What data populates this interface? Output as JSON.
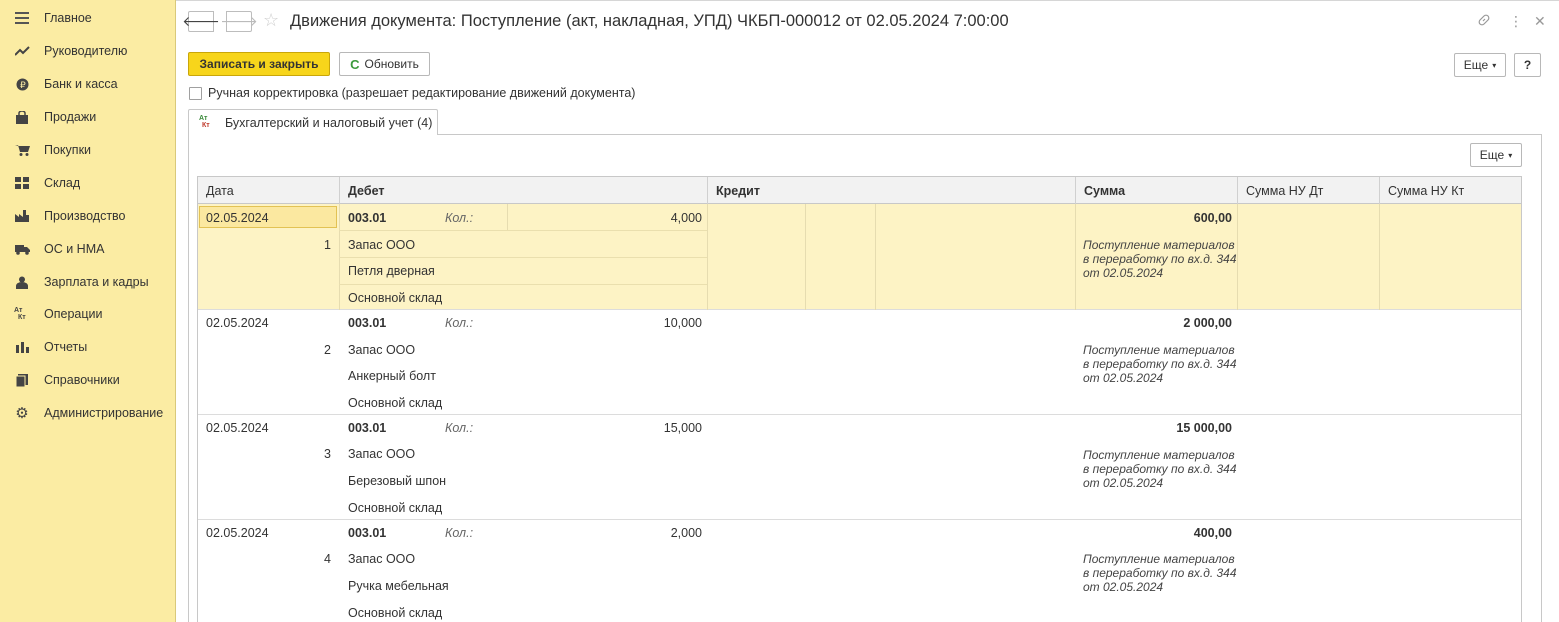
{
  "sidebar": {
    "items": [
      {
        "label": "Главное",
        "icon": "menu-icon"
      },
      {
        "label": "Руководителю",
        "icon": "trend-icon"
      },
      {
        "label": "Банк и касса",
        "icon": "coin-icon"
      },
      {
        "label": "Продажи",
        "icon": "bag-icon"
      },
      {
        "label": "Покупки",
        "icon": "cart-icon"
      },
      {
        "label": "Склад",
        "icon": "warehouse-icon"
      },
      {
        "label": "Производство",
        "icon": "factory-icon"
      },
      {
        "label": "ОС и НМА",
        "icon": "truck-icon"
      },
      {
        "label": "Зарплата и кадры",
        "icon": "person-icon"
      },
      {
        "label": "Операции",
        "icon": "dt-kt-icon"
      },
      {
        "label": "Отчеты",
        "icon": "bar-chart-icon"
      },
      {
        "label": "Справочники",
        "icon": "book-icon"
      },
      {
        "label": "Администрирование",
        "icon": "gear-icon"
      }
    ]
  },
  "header": {
    "title": "Движения документа: Поступление (акт, накладная, УПД) ЧКБП-000012 от 02.05.2024 7:00:00"
  },
  "toolbar": {
    "save_close": "Записать и закрыть",
    "refresh": "Обновить",
    "more": "Еще",
    "help": "?"
  },
  "manual_correction": "Ручная корректировка (разрешает редактирование движений документа)",
  "tab": {
    "label": "Бухгалтерский и налоговый учет (4)",
    "more": "Еще"
  },
  "table": {
    "columns": [
      "Дата",
      "Дебет",
      "Кредит",
      "Сумма",
      "Сумма НУ Дт",
      "Сумма НУ Кт"
    ],
    "qty_label": "Кол.:",
    "rows": [
      {
        "date": "02.05.2024",
        "num": "1",
        "account": "003.01",
        "qty": "4,000",
        "sub1": "Запас ООО",
        "sub2": "Петля дверная",
        "sub3": "Основной склад",
        "sum": "600,00",
        "comment": "Поступление материалов в переработку по вх.д. 344 от 02.05.2024"
      },
      {
        "date": "02.05.2024",
        "num": "2",
        "account": "003.01",
        "qty": "10,000",
        "sub1": "Запас ООО",
        "sub2": "Анкерный болт",
        "sub3": "Основной склад",
        "sum": "2 000,00",
        "comment": "Поступление материалов в переработку по вх.д. 344 от 02.05.2024"
      },
      {
        "date": "02.05.2024",
        "num": "3",
        "account": "003.01",
        "qty": "15,000",
        "sub1": "Запас ООО",
        "sub2": "Березовый шпон",
        "sub3": "Основной склад",
        "sum": "15 000,00",
        "comment": "Поступление материалов в переработку по вх.д. 344 от 02.05.2024"
      },
      {
        "date": "02.05.2024",
        "num": "4",
        "account": "003.01",
        "qty": "2,000",
        "sub1": "Запас ООО",
        "sub2": "Ручка мебельная",
        "sub3": "Основной склад",
        "sum": "400,00",
        "comment": "Поступление материалов в переработку по вх.д. 344 от 02.05.2024"
      }
    ]
  }
}
